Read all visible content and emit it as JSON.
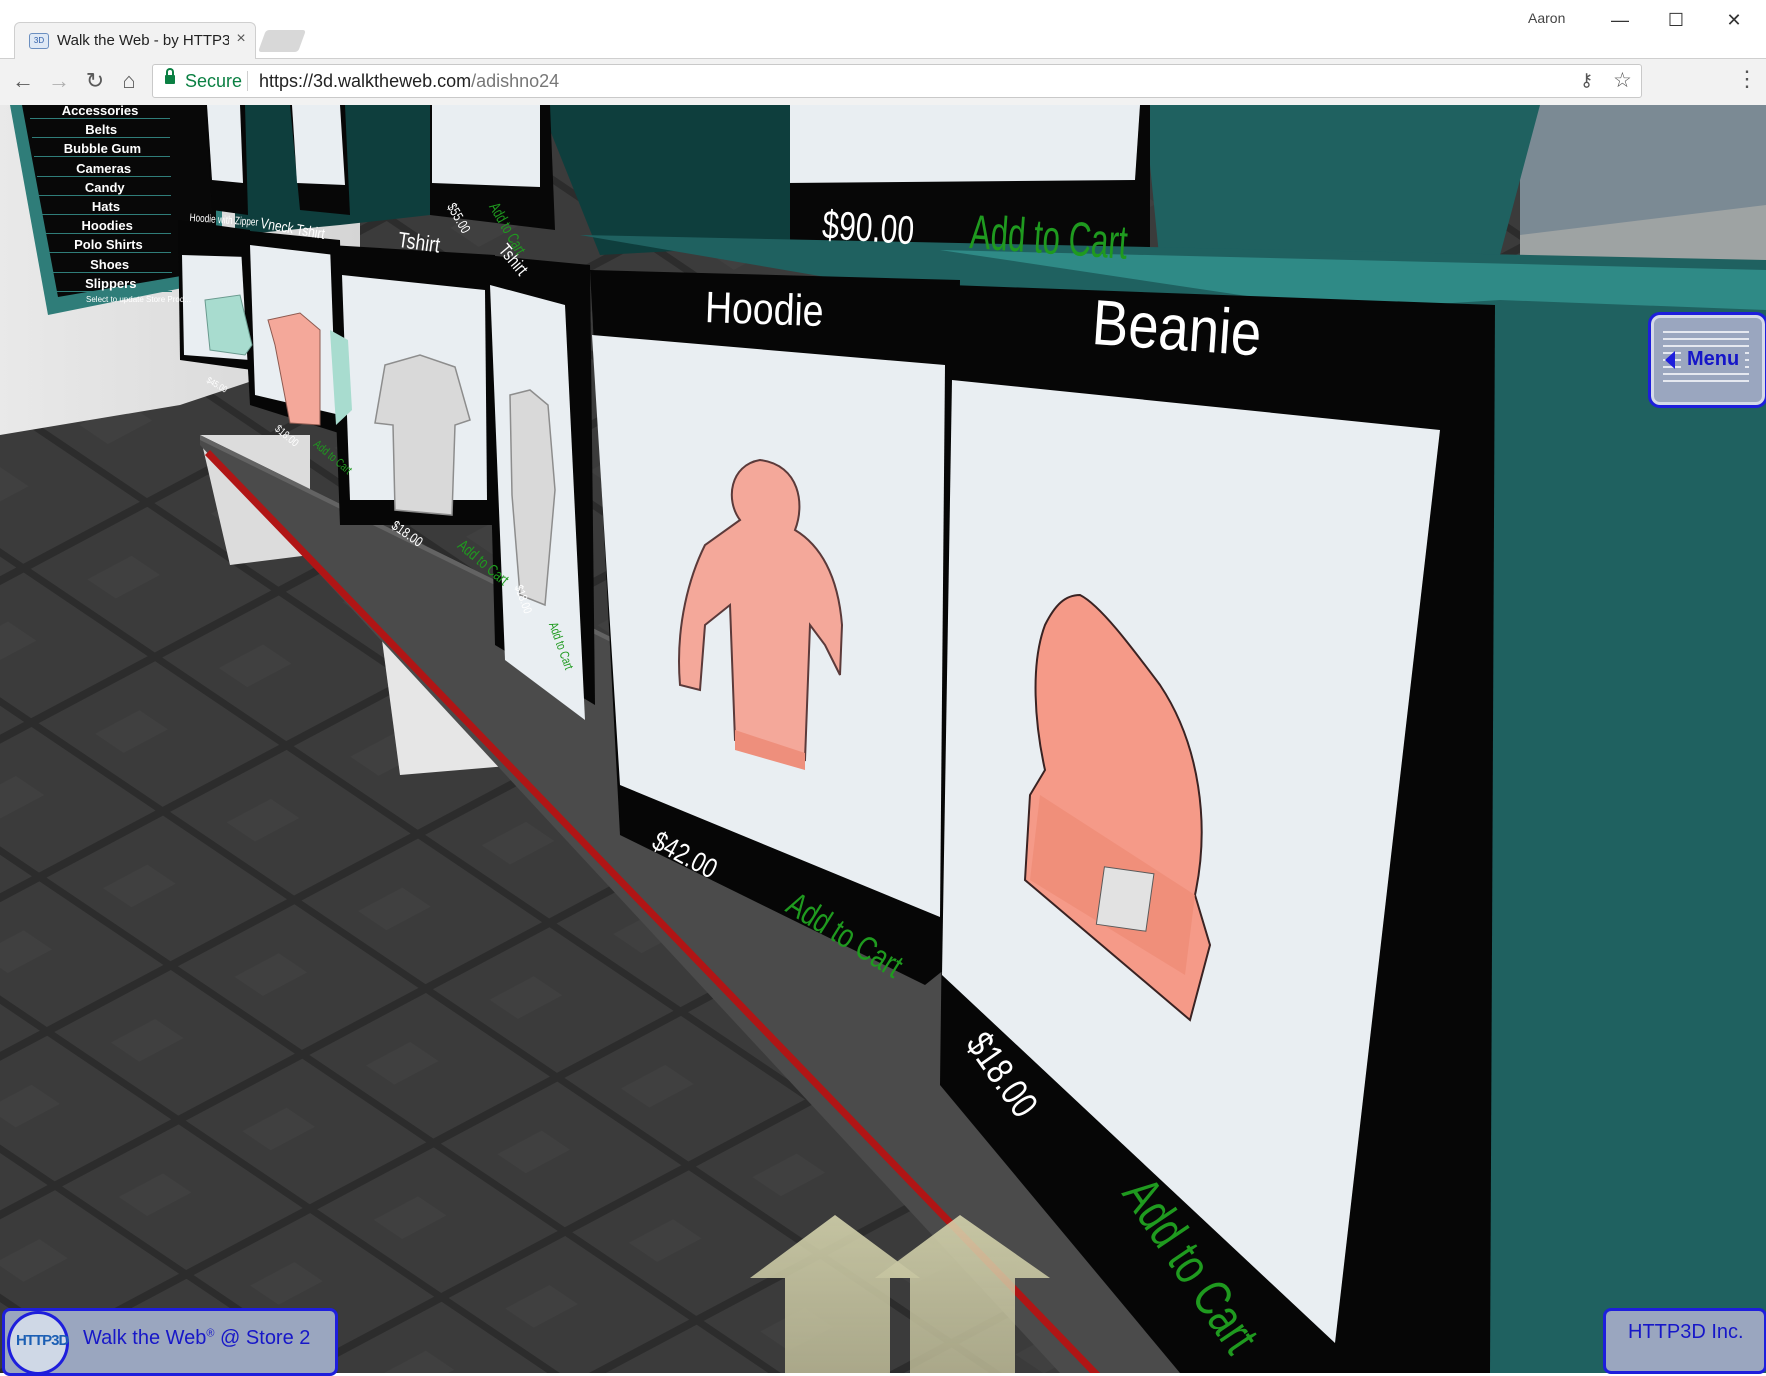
{
  "browser": {
    "tab_title": "Walk the Web - by HTTP3D",
    "tab_close": "×",
    "profile_name": "Aaron",
    "window_controls": {
      "minimize": "—",
      "maximize": "☐",
      "close": "✕"
    },
    "nav": {
      "back": "←",
      "forward": "→",
      "reload": "↻",
      "home": "⌂"
    },
    "secure_label": "Secure",
    "url_host": "https://3d.walktheweb.com",
    "url_path": "/adishno24",
    "icons": [
      "lock-icon",
      "key-icon",
      "star-icon",
      "kebab-icon"
    ]
  },
  "scene": {
    "category_menu": {
      "items": [
        "Accessories",
        "Belts",
        "Bubble Gum",
        "Cameras",
        "Candy",
        "Hats",
        "Hoodies",
        "Polo Shirts",
        "Shoes",
        "Slippers"
      ],
      "footer": "Select to update Store Prod..."
    },
    "products": [
      {
        "name": "Hoodie",
        "price": "$42.00",
        "cta": "Add to Cart"
      },
      {
        "name": "Beanie",
        "price": "$18.00",
        "cta": "Add to Cart"
      },
      {
        "name": "Tshirt",
        "price": "$18.00",
        "cta": "Add to Cart"
      },
      {
        "name": "Tshirt",
        "price": "$18.00",
        "cta": "Add to Cart"
      },
      {
        "name": "Vneck Tshirt",
        "price": "$18.00",
        "cta": "Add to Cart"
      },
      {
        "name": "Hoodie with Zipper",
        "price": "$45.00",
        "cta": "Add to Cart"
      }
    ],
    "upper_shelf": [
      {
        "price": "$90.00",
        "cta": "Add to Cart"
      },
      {
        "price": "$55.00",
        "cta": "Add to Cart"
      }
    ]
  },
  "overlay": {
    "menu_label": "Menu",
    "store_prefix": "Walk the Web",
    "store_reg": "®",
    "store_suffix": " @ Store 2",
    "logo_text": "HTTP3D",
    "company": "HTTP3D Inc."
  },
  "colors": {
    "teal_box": "#1f6160",
    "teal_top": "#2f8a86",
    "panel_black": "#060606",
    "cart_green": "#1f9a1f",
    "menu_blue": "#1e1edc",
    "floor": "#3a3a3a",
    "accent_red": "#b01515"
  }
}
